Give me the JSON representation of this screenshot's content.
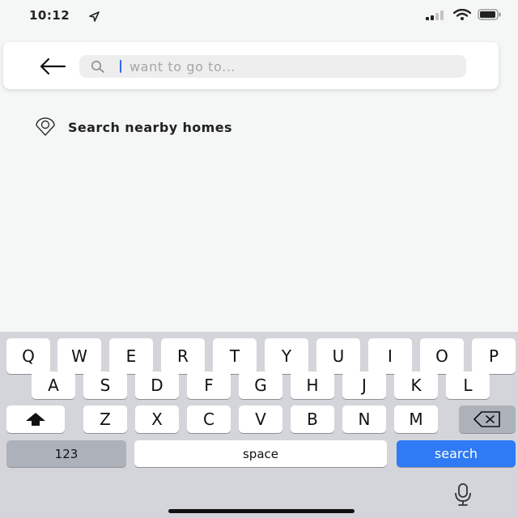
{
  "status_bar": {
    "time": "10:12"
  },
  "search": {
    "placeholder": "want to go to...",
    "value": ""
  },
  "nearby": {
    "label": "Search nearby homes"
  },
  "keyboard": {
    "row1": [
      "Q",
      "W",
      "E",
      "R",
      "T",
      "Y",
      "U",
      "I",
      "O",
      "P"
    ],
    "row2": [
      "A",
      "S",
      "D",
      "F",
      "G",
      "H",
      "J",
      "K",
      "L"
    ],
    "row3": [
      "Z",
      "X",
      "C",
      "V",
      "B",
      "N",
      "M"
    ],
    "numbers_label": "123",
    "space_label": "space",
    "search_label": "search"
  }
}
